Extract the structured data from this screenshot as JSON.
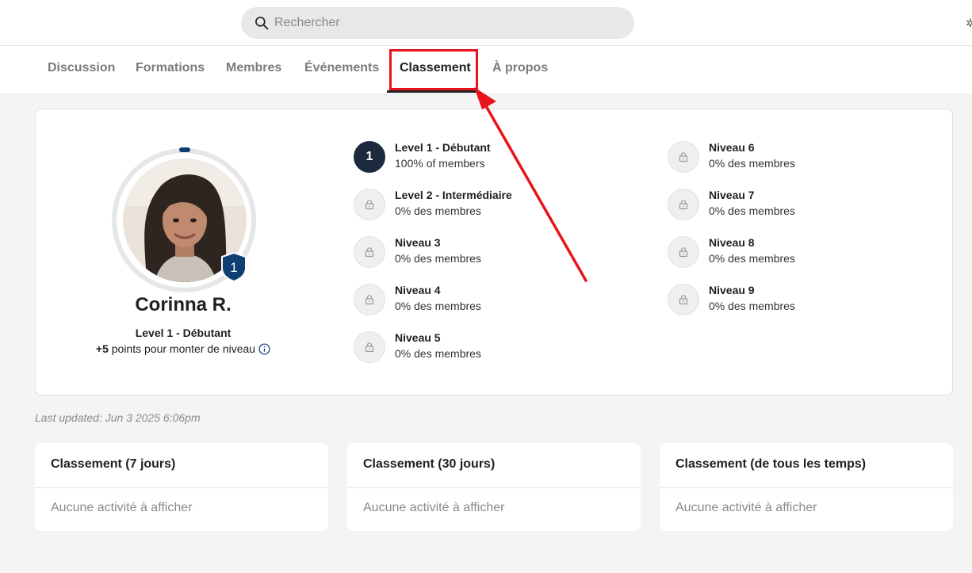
{
  "search": {
    "placeholder": "Rechercher"
  },
  "tabs": [
    {
      "label": "Discussion"
    },
    {
      "label": "Formations"
    },
    {
      "label": "Membres"
    },
    {
      "label": "Événements"
    },
    {
      "label": "Classement",
      "active": true
    },
    {
      "label": "À propos"
    }
  ],
  "profile": {
    "name": "Corinna R.",
    "level_label": "Level 1 - Débutant",
    "badge_number": "1",
    "points_value": "+5",
    "points_text": "points pour monter de niveau"
  },
  "levels": [
    {
      "badge": "1",
      "name": "Level 1 - Débutant",
      "percent": "100% of members",
      "unlocked": true
    },
    {
      "name": "Level 2 - Intermédiaire",
      "percent": "0% des membres",
      "unlocked": false
    },
    {
      "name": "Niveau 3",
      "percent": "0% des membres",
      "unlocked": false
    },
    {
      "name": "Niveau 4",
      "percent": "0% des membres",
      "unlocked": false
    },
    {
      "name": "Niveau 5",
      "percent": "0% des membres",
      "unlocked": false
    },
    {
      "name": "Niveau 6",
      "percent": "0% des membres",
      "unlocked": false
    },
    {
      "name": "Niveau 7",
      "percent": "0% des membres",
      "unlocked": false
    },
    {
      "name": "Niveau 8",
      "percent": "0% des membres",
      "unlocked": false
    },
    {
      "name": "Niveau 9",
      "percent": "0% des membres",
      "unlocked": false
    }
  ],
  "last_updated": "Last updated: Jun 3 2025 6:06pm",
  "leaderboards": [
    {
      "title": "Classement (7 jours)",
      "empty": "Aucune activité à afficher"
    },
    {
      "title": "Classement (30 jours)",
      "empty": "Aucune activité à afficher"
    },
    {
      "title": "Classement (de tous les temps)",
      "empty": "Aucune activité à afficher"
    }
  ],
  "colors": {
    "accent_dark": "#1d2a3e",
    "badge_blue": "#0f3e72",
    "annotation_red": "#e8131b"
  },
  "icons": {
    "search": "search-icon",
    "lock": "lock-icon",
    "info": "info-icon",
    "level_badge": "shield-badge-icon"
  }
}
